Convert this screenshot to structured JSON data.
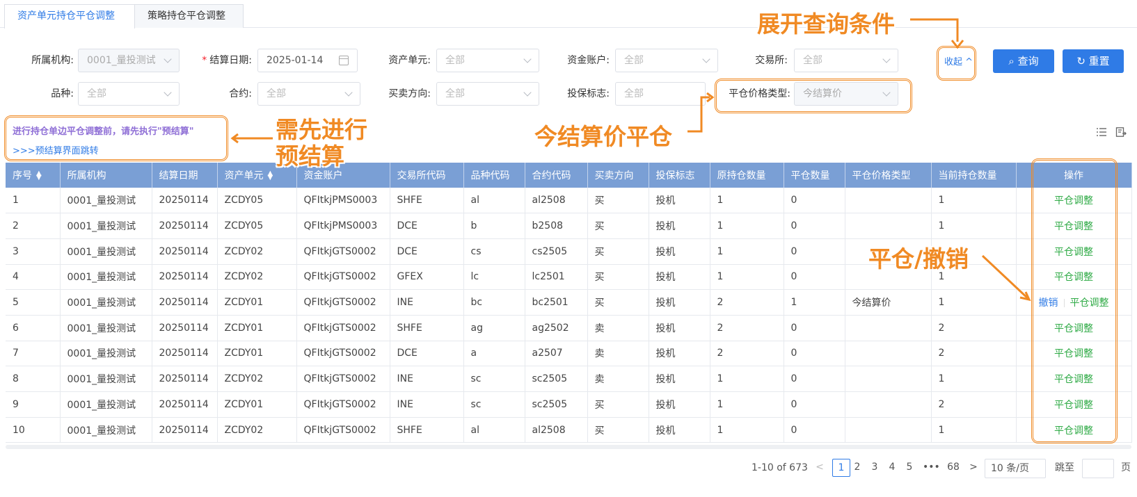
{
  "tabs": [
    {
      "label": "资产单元持仓平仓调整",
      "active": true
    },
    {
      "label": "策略持仓平仓调整",
      "active": false
    }
  ],
  "filters": {
    "org_label": "所属机构:",
    "org_value": "0001_量投测试",
    "date_label": "结算日期:",
    "date_value": "2025-01-14",
    "asset_label": "资产单元:",
    "asset_value": "全部",
    "account_label": "资金账户:",
    "account_value": "全部",
    "exchange_label": "交易所:",
    "exchange_value": "全部",
    "variety_label": "品种:",
    "variety_value": "全部",
    "contract_label": "合约:",
    "contract_value": "全部",
    "direction_label": "买卖方向:",
    "direction_value": "全部",
    "hedge_label": "投保标志:",
    "hedge_value": "全部",
    "price_type_label": "平仓价格类型:",
    "price_type_value": "今结算价"
  },
  "actions": {
    "collapse": "收起",
    "query": "查询",
    "reset": "重置"
  },
  "notice": {
    "text": "进行持仓单边平仓调整前，请先执行\"预结算\"",
    "link": ">>>预结算界面跳转"
  },
  "table": {
    "headers": [
      "序号",
      "所属机构",
      "结算日期",
      "资产单元",
      "资金账户",
      "交易所代码",
      "品种代码",
      "合约代码",
      "买卖方向",
      "投保标志",
      "原持仓数量",
      "平仓数量",
      "平仓价格类型",
      "当前持仓数量",
      "操作"
    ],
    "rows": [
      [
        "1",
        "0001_量投测试",
        "20250114",
        "ZCDY05",
        "QFItkjPMS0003",
        "SHFE",
        "al",
        "al2508",
        "买",
        "投机",
        "1",
        "0",
        "",
        "1"
      ],
      [
        "2",
        "0001_量投测试",
        "20250114",
        "ZCDY05",
        "QFItkjPMS0003",
        "DCE",
        "b",
        "b2508",
        "买",
        "投机",
        "1",
        "0",
        "",
        "1"
      ],
      [
        "3",
        "0001_量投测试",
        "20250114",
        "ZCDY02",
        "QFItkjGTS0002",
        "DCE",
        "cs",
        "cs2505",
        "买",
        "投机",
        "1",
        "0",
        "",
        "1"
      ],
      [
        "4",
        "0001_量投测试",
        "20250114",
        "ZCDY02",
        "QFItkjGTS0002",
        "GFEX",
        "lc",
        "lc2501",
        "买",
        "投机",
        "1",
        "0",
        "",
        "1"
      ],
      [
        "5",
        "0001_量投测试",
        "20250114",
        "ZCDY01",
        "QFItkjGTS0002",
        "INE",
        "bc",
        "bc2501",
        "买",
        "投机",
        "2",
        "1",
        "今结算价",
        "1"
      ],
      [
        "6",
        "0001_量投测试",
        "20250114",
        "ZCDY01",
        "QFItkjGTS0002",
        "SHFE",
        "ag",
        "ag2502",
        "卖",
        "投机",
        "2",
        "0",
        "",
        "2"
      ],
      [
        "7",
        "0001_量投测试",
        "20250114",
        "ZCDY01",
        "QFItkjGTS0002",
        "DCE",
        "a",
        "a2507",
        "卖",
        "投机",
        "2",
        "0",
        "",
        "2"
      ],
      [
        "8",
        "0001_量投测试",
        "20250114",
        "ZCDY02",
        "QFItkjGTS0002",
        "INE",
        "sc",
        "sc2505",
        "卖",
        "投机",
        "1",
        "0",
        "",
        "1"
      ],
      [
        "9",
        "0001_量投测试",
        "20250114",
        "ZCDY01",
        "QFItkjGTS0002",
        "INE",
        "sc",
        "sc2505",
        "买",
        "投机",
        "1",
        "0",
        "",
        "2"
      ],
      [
        "10",
        "0001_量投测试",
        "20250114",
        "ZCDY02",
        "QFItkjGTS0002",
        "SHFE",
        "al",
        "al2508",
        "买",
        "投机",
        "1",
        "0",
        "",
        "1"
      ]
    ],
    "op_adjust": "平仓调整",
    "op_cancel": "撤销"
  },
  "pagination": {
    "summary": "1-10 of 673",
    "pages": [
      "1",
      "2",
      "3",
      "4",
      "5",
      "•••",
      "68"
    ],
    "page_size": "10 条/页",
    "goto_label": "跳至",
    "goto_suffix": "页"
  },
  "annotations": {
    "expand": "展开查询条件",
    "need_pre": "需先进行",
    "need_pre2": "预结算",
    "today_price": "今结算价平仓",
    "close_cancel": "平仓/撤销"
  },
  "colors": {
    "primary": "#2f7be6",
    "header_bg": "#7a9fd5",
    "action_green": "#2eaa45",
    "annotation": "#f08a24"
  }
}
